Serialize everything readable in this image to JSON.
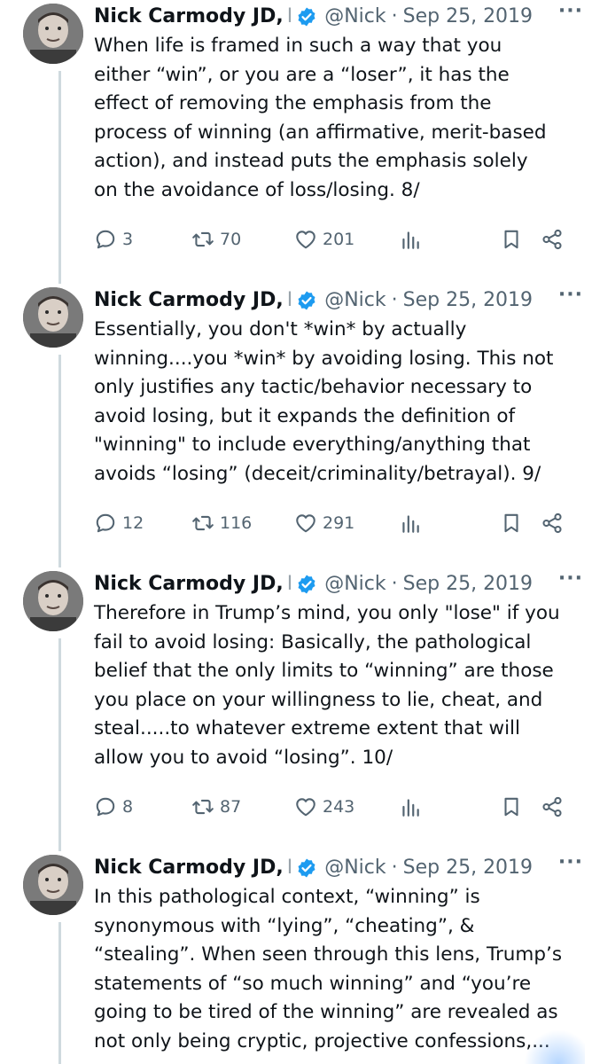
{
  "author": {
    "name": "Nick Carmody JD,",
    "name_tail": "I",
    "handle": "@Nick",
    "separator": "·"
  },
  "more_label": "···",
  "tweets": [
    {
      "date": "Sep 25, 2019",
      "text": "When life is framed in such a way that you\neither “win”, or you are a “loser”, it has the\neffect of removing the emphasis from the\nprocess of winning (an affirmative, merit-based\naction), and instead puts the emphasis solely\non the avoidance of loss/losing. 8/",
      "replies": "3",
      "retweets": "70",
      "likes": "201"
    },
    {
      "date": "Sep 25, 2019",
      "text": "Essentially, you don't *win* by actually\nwinning....you *win* by avoiding losing. This not\nonly justifies any tactic/behavior necessary to\navoid losing, but it expands the definition of\n\"winning\" to include everything/anything that\navoids “losing” (deceit/criminality/betrayal). 9/",
      "replies": "12",
      "retweets": "116",
      "likes": "291"
    },
    {
      "date": "Sep 25, 2019",
      "text": "Therefore in Trump’s mind, you only \"lose\" if you\nfail to avoid losing:  Basically, the pathological\nbelief that the only limits to “winning” are those\nyou place on your willingness to lie, cheat, and\nsteal.....to whatever extreme extent that will\nallow you to avoid “losing”. 10/",
      "replies": "8",
      "retweets": "87",
      "likes": "243"
    },
    {
      "date": "Sep 25, 2019",
      "text": "In this pathological context, “winning” is\nsynonymous with “lying”, “cheating”, &\n“stealing”. When seen through this lens, Trump’s\nstatements of “so much winning” and “you’re\ngoing to be tired of the winning” are revealed as\nnot only being cryptic, projective confessions,...",
      "replies": "",
      "retweets": "",
      "likes": ""
    }
  ],
  "colors": {
    "text": "#0f1419",
    "secondary": "#536471",
    "verified": "#1d9bf0",
    "thread_line": "#cfd9de"
  },
  "icons": [
    "reply-icon",
    "retweet-icon",
    "like-icon",
    "views-icon",
    "bookmark-icon",
    "share-icon",
    "verified-badge-icon"
  ]
}
